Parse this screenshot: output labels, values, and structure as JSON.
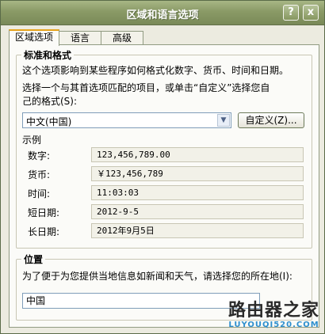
{
  "window": {
    "title": "区域和语言选项",
    "help_label": "?",
    "close_label": "x"
  },
  "tabs": [
    "区域选项",
    "语言",
    "高级"
  ],
  "standards": {
    "group_title": "标准和格式",
    "description": "这个选项影响到某些程序如何格式化数字、货币、时间和日期。",
    "instruction_line1": "选择一个与其首选项匹配的项目，或单击“自定义”选择您自",
    "instruction_line2": "己的格式(S):",
    "format_value": "中文(中国)",
    "customize_label": "自定义(Z)...",
    "samples_title": "示例",
    "samples": [
      {
        "label": "数字:",
        "value": "123,456,789.00"
      },
      {
        "label": "货币:",
        "value": "￥123,456,789"
      },
      {
        "label": "时间:",
        "value": "11:03:03"
      },
      {
        "label": "短日期:",
        "value": "2012-9-5"
      },
      {
        "label": "长日期:",
        "value": "2012年9月5日"
      }
    ]
  },
  "location": {
    "group_title": "位置",
    "description": "为了便于为您提供当地信息如新闻和天气，请选择您的所在地(I):",
    "value": "中国"
  },
  "watermark": {
    "main": "路由器之家",
    "sub": "LUYOUQI520.COM"
  },
  "colors": {
    "titlebar": "#8a9a66",
    "tab_highlight": "#e4a21a",
    "dialog_bg": "#ecebe0"
  }
}
